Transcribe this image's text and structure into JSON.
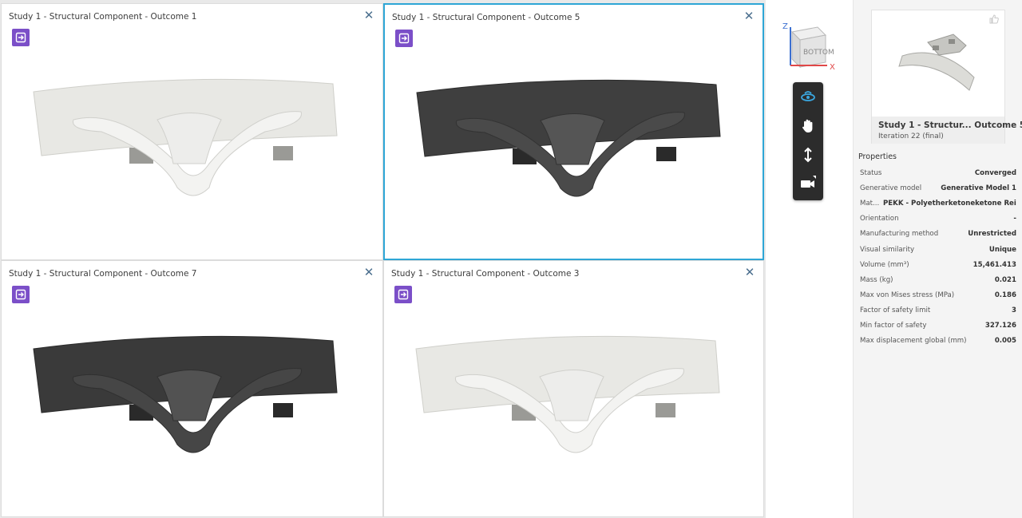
{
  "viewports": [
    {
      "title": "Study 1 - Structural Component - Outcome 1",
      "shade": "light",
      "selected": false
    },
    {
      "title": "Study 1 - Structural Component - Outcome 5",
      "shade": "dark",
      "selected": true
    },
    {
      "title": "Study 1 - Structural Component - Outcome 7",
      "shade": "dark",
      "selected": false
    },
    {
      "title": "Study 1 - Structural Component - Outcome 3",
      "shade": "light",
      "selected": false
    }
  ],
  "view_cube": {
    "face": "BOTTOM",
    "axis_z": "Z",
    "axis_x": "X"
  },
  "nav_tools": [
    "orbit-icon",
    "pan-hand-icon",
    "zoom-icon",
    "camera-icon"
  ],
  "panel": {
    "thumbnail_title": "Study 1 - Structur... Outcome 5",
    "thumbnail_subtitle": "Iteration 22 (final)",
    "properties_heading": "Properties",
    "properties": [
      {
        "label": "Status",
        "value": "Converged"
      },
      {
        "label": "Generative model",
        "value": "Generative Model 1"
      },
      {
        "label": "Mat...",
        "value": "PEKK - Polyetherketoneketone Reinfor..."
      },
      {
        "label": "Orientation",
        "value": "-"
      },
      {
        "label": "Manufacturing method",
        "value": "Unrestricted"
      },
      {
        "label": "Visual similarity",
        "value": "Unique"
      },
      {
        "label": "Volume (mm³)",
        "value": "15,461.413"
      },
      {
        "label": "Mass (kg)",
        "value": "0.021"
      },
      {
        "label": "Max von Mises stress (MPa)",
        "value": "0.186"
      },
      {
        "label": "Factor of safety limit",
        "value": "3"
      },
      {
        "label": "Min factor of safety",
        "value": "327.126"
      },
      {
        "label": "Max displacement global (mm)",
        "value": "0.005"
      }
    ]
  },
  "colors": {
    "selected_border": "#2ea6d6",
    "open_button": "#7b4fc8",
    "close_x": "#4b6f8e"
  }
}
